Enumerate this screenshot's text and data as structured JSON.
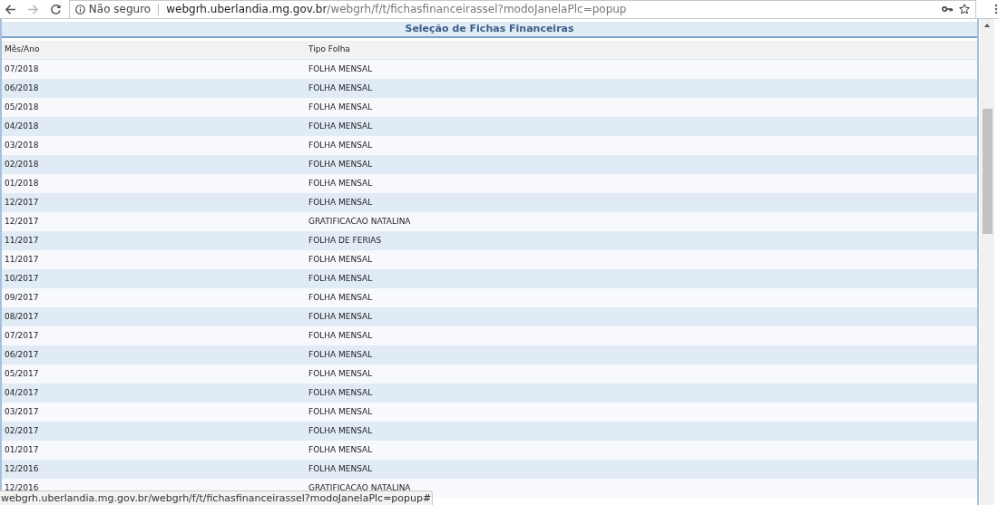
{
  "browser": {
    "security_label": "Não seguro",
    "url_host": "webgrh.uberlandia.mg.gov.br",
    "url_path": "/webgrh/f/t/fichasfinanceirassel?modoJanelaPlc=popup"
  },
  "panel": {
    "title": "Seleção de Fichas Financeiras"
  },
  "table": {
    "columns": [
      "Mês/Ano",
      "Tipo Folha"
    ],
    "rows": [
      [
        "07/2018",
        "FOLHA MENSAL"
      ],
      [
        "06/2018",
        "FOLHA MENSAL"
      ],
      [
        "05/2018",
        "FOLHA MENSAL"
      ],
      [
        "04/2018",
        "FOLHA MENSAL"
      ],
      [
        "03/2018",
        "FOLHA MENSAL"
      ],
      [
        "02/2018",
        "FOLHA MENSAL"
      ],
      [
        "01/2018",
        "FOLHA MENSAL"
      ],
      [
        "12/2017",
        "FOLHA MENSAL"
      ],
      [
        "12/2017",
        "GRATIFICACAO NATALINA"
      ],
      [
        "11/2017",
        "FOLHA DE FERIAS"
      ],
      [
        "11/2017",
        "FOLHA MENSAL"
      ],
      [
        "10/2017",
        "FOLHA MENSAL"
      ],
      [
        "09/2017",
        "FOLHA MENSAL"
      ],
      [
        "08/2017",
        "FOLHA MENSAL"
      ],
      [
        "07/2017",
        "FOLHA MENSAL"
      ],
      [
        "06/2017",
        "FOLHA MENSAL"
      ],
      [
        "05/2017",
        "FOLHA MENSAL"
      ],
      [
        "04/2017",
        "FOLHA MENSAL"
      ],
      [
        "03/2017",
        "FOLHA MENSAL"
      ],
      [
        "02/2017",
        "FOLHA MENSAL"
      ],
      [
        "01/2017",
        "FOLHA MENSAL"
      ],
      [
        "12/2016",
        "FOLHA MENSAL"
      ],
      [
        "12/2016",
        "GRATIFICACAO NATALINA"
      ]
    ]
  },
  "status_bar": {
    "text": "webgrh.uberlandia.mg.gov.br/webgrh/f/t/fichasfinanceirassel?modoJanelaPlc=popup#"
  }
}
